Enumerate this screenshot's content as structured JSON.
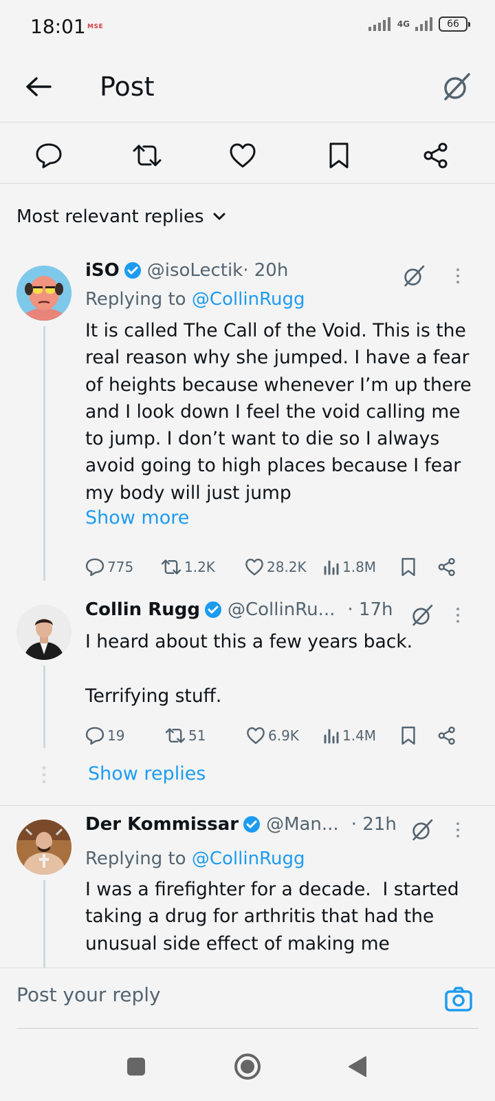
{
  "status_bar": {
    "time": "18:01",
    "carrier_badge": "MSE",
    "network": "4G",
    "battery": "66"
  },
  "header": {
    "title": "Post"
  },
  "sort": {
    "label": "Most relevant replies"
  },
  "replies": [
    {
      "name": "iSO",
      "handle": "@isoLectik",
      "time": "· 20h",
      "replying_prefix": "Replying to ",
      "replying_to": "@CollinRugg",
      "text": "It is called The Call of the Void. This is the real reason why she jumped. I have a fear of heights because whenever I’m up there and I look down I feel the void calling me to jump. I don’t want to die so I always avoid going to high places because I fear my body will just jump",
      "show_more": "Show more",
      "stats": {
        "replies": "775",
        "reposts": "1.2K",
        "likes": "28.2K",
        "views": "1.8M"
      }
    },
    {
      "name": "Collin Rugg",
      "handle": "@CollinRu...",
      "time": "· 17h",
      "text": "I heard about this a few years back.\n\nTerrifying stuff.",
      "stats": {
        "replies": "19",
        "reposts": "51",
        "likes": "6.9K",
        "views": "1.4M"
      },
      "show_replies": "Show replies"
    },
    {
      "name": "Der Kommissar",
      "handle": "@Man...",
      "time": "· 21h",
      "replying_prefix": "Replying to ",
      "replying_to": "@CollinRugg",
      "text": "I was a firefighter for a decade.  I started taking a drug for arthritis that had the unusual side effect of making me"
    }
  ],
  "compose": {
    "placeholder": "Post your reply"
  },
  "colors": {
    "accent": "#1d9bf0",
    "text": "#0f1419",
    "muted": "#536471",
    "background": "#f4f4f4"
  }
}
